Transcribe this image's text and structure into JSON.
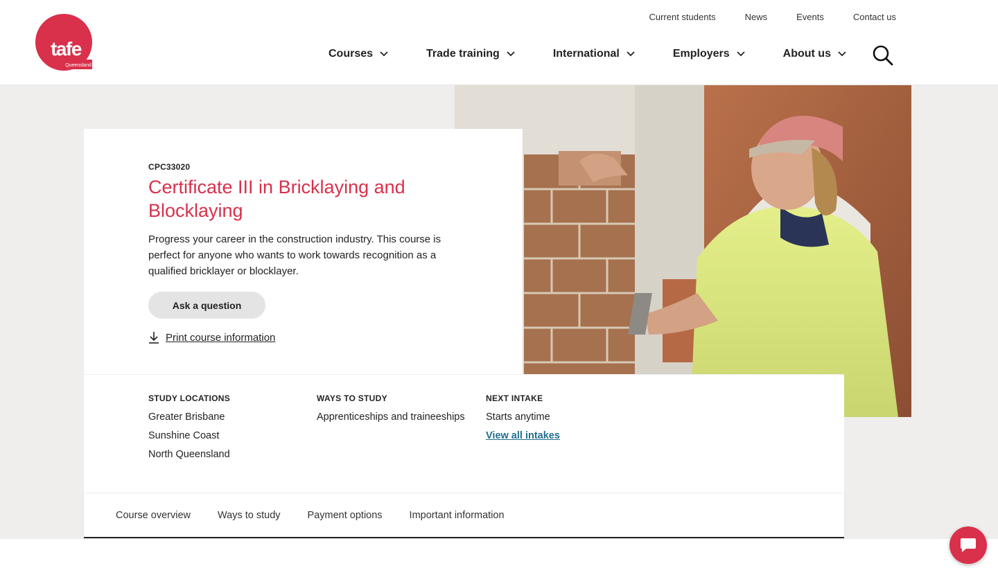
{
  "brand": {
    "logo_text": "tafe",
    "logo_subtext": "Queensland",
    "accent": "#d9304b"
  },
  "utility_nav": [
    "Current students",
    "News",
    "Events",
    "Contact us"
  ],
  "main_nav": [
    {
      "label": "Courses",
      "icon": "chevron-down-icon"
    },
    {
      "label": "Trade training",
      "icon": "chevron-down-icon"
    },
    {
      "label": "International",
      "icon": "chevron-down-icon"
    },
    {
      "label": "Employers",
      "icon": "chevron-down-icon"
    },
    {
      "label": "About us",
      "icon": "chevron-down-icon"
    }
  ],
  "search": {
    "icon": "search-icon"
  },
  "course": {
    "code": "CPC33020",
    "title": "Certificate III in Bricklaying and Blocklaying",
    "description": "Progress your career in the construction industry. This course is perfect for anyone who wants to work towards recognition as a qualified bricklayer or blocklayer.",
    "ask_button": "Ask a question",
    "print_link": "Print course information"
  },
  "info": {
    "locations": {
      "heading": "STUDY LOCATIONS",
      "items": [
        "Greater Brisbane",
        "Sunshine Coast",
        "North Queensland"
      ]
    },
    "ways": {
      "heading": "WAYS TO STUDY",
      "items": [
        "Apprenticeships and traineeships"
      ]
    },
    "intake": {
      "heading": "NEXT INTAKE",
      "value": "Starts anytime",
      "link": "View all intakes"
    }
  },
  "tabs": [
    "Course overview",
    "Ways to study",
    "Payment options",
    "Important information"
  ],
  "chat": {
    "icon": "chat-icon"
  }
}
